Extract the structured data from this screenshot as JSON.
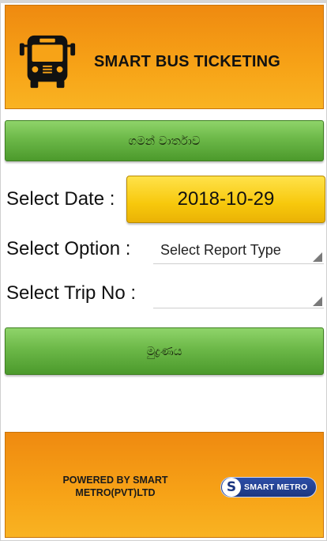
{
  "header": {
    "title": "SMART BUS TICKETING",
    "icon": "bus-icon"
  },
  "buttons": {
    "route_report": "ගමන් වාර්තාව",
    "print": "මුද්‍රණය"
  },
  "form": {
    "date_label": "Select Date :",
    "date_value": "2018-10-29",
    "option_label": "Select Option :",
    "option_value": "Select Report Type",
    "trip_label": "Select Trip No :",
    "trip_value": ""
  },
  "footer": {
    "powered_by": "POWERED BY SMART METRO(PVT)LTD",
    "logo_text": "SMART METRO",
    "logo_letter": "S"
  },
  "colors": {
    "header_orange": "#f7a317",
    "button_green": "#6cb848",
    "date_yellow": "#f7c80c",
    "logo_blue": "#1c3680"
  }
}
